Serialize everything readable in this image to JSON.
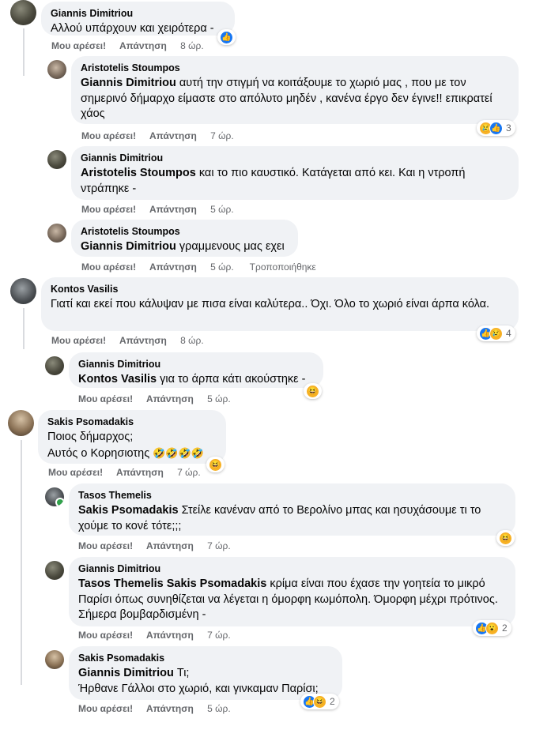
{
  "actions": {
    "like": "Μου αρέσει!",
    "reply": "Απάντηση",
    "edited": "Τροποποιήθηκε"
  },
  "comments": [
    {
      "author": "Giannis Dimitriou",
      "text": "Αλλού υπάρχουν και χειρότερα -",
      "time": "8 ώρ.",
      "reaction_icons": [
        "like-icon"
      ],
      "reaction_count": ""
    },
    {
      "author": "Aristotelis Stoumpos",
      "mention": "Giannis Dimitriou",
      "text": "αυτή την στιγμή να κοιτάξουμε το χωριό μας , που με τον σημερινό δήμαρχο είμαστε στο απόλυτο μηδέν , κανένα έργο δεν έγινε!! επικρατεί χάος",
      "time": "7 ώρ.",
      "reaction_icons": [
        "sad-icon",
        "like-icon"
      ],
      "reaction_count": "3"
    },
    {
      "author": "Giannis Dimitriou",
      "mention": "Aristotelis Stoumpos",
      "text": "και το πιο καυστικό. Κατάγεται από κει. Και η ντροπή ντράπηκε -",
      "time": "5 ώρ."
    },
    {
      "author": "Aristotelis Stoumpos",
      "mention": "Giannis Dimitriou",
      "text": "γραμμενους μας εχει",
      "time": "5 ώρ.",
      "edited": true
    },
    {
      "author": "Kontos Vasilis",
      "text": "Γιατί και εκεί που κάλυψαν με πισα είναι καλύτερα.. Όχι. Όλο το χωριό είναι άρπα κόλα.",
      "time": "8 ώρ.",
      "reaction_icons": [
        "like-icon",
        "sad-icon"
      ],
      "reaction_count": "4"
    },
    {
      "author": "Giannis Dimitriou",
      "mention": "Kontos Vasilis",
      "text": "για το άρπα κάτι ακούστηκε -",
      "time": "5 ώρ.",
      "reaction_icons": [
        "haha-icon"
      ],
      "reaction_count": ""
    },
    {
      "author": "Sakis Psomadakis",
      "text_line1": "Ποιος δήμαρχος;",
      "text_line2": "Αυτός ο Κορησιοτης",
      "text_emoji": "🤣🤣🤣🤣",
      "time": "7 ώρ.",
      "reaction_icons": [
        "haha-icon"
      ],
      "reaction_count": ""
    },
    {
      "author": "Tasos Themelis",
      "mention": "Sakis Psomadakis",
      "text": "Στείλε κανέναν από το Βερολίνο μπας και ησυχάσουμε τι το χούμε το κονέ τότε;;;",
      "time": "7 ώρ.",
      "reaction_icons": [
        "haha-icon"
      ],
      "reaction_count": ""
    },
    {
      "author": "Giannis Dimitriou",
      "mention": "Tasos Themelis Sakis Psomadakis",
      "text": "κρίμα είναι που έχασε την γοητεία το μικρό Παρίσι όπως συνηθίζεται να λέγεται η όμορφη κωμόπολη. Όμορφη μέχρι πρότινος. Σήμερα βομβαρδισμένη -",
      "time": "7 ώρ.",
      "reaction_icons": [
        "like-icon",
        "wow-icon"
      ],
      "reaction_count": "2"
    },
    {
      "author": "Sakis Psomadakis",
      "mention": "Giannis Dimitriou",
      "text_line1": "Τι;",
      "text_line2": "Ήρθανε Γάλλοι στο χωριό, και γινκαμαν Παρίσι;",
      "time": "5 ώρ.",
      "reaction_icons": [
        "like-icon",
        "haha-icon"
      ],
      "reaction_count": "2"
    }
  ]
}
